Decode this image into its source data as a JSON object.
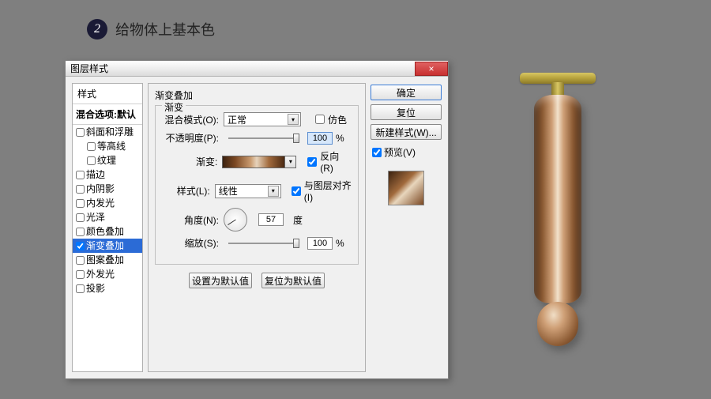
{
  "step": {
    "num": "2",
    "title": "给物体上基本色"
  },
  "dialog": {
    "title": "图层样式",
    "close": "×",
    "sidebar": {
      "heading": "样式",
      "sub": "混合选项:默认",
      "items": [
        {
          "label": "斜面和浮雕",
          "checked": false,
          "indent": false
        },
        {
          "label": "等高线",
          "checked": false,
          "indent": true
        },
        {
          "label": "纹理",
          "checked": false,
          "indent": true
        },
        {
          "label": "描边",
          "checked": false,
          "indent": false
        },
        {
          "label": "内阴影",
          "checked": false,
          "indent": false
        },
        {
          "label": "内发光",
          "checked": false,
          "indent": false
        },
        {
          "label": "光泽",
          "checked": false,
          "indent": false
        },
        {
          "label": "颜色叠加",
          "checked": false,
          "indent": false
        },
        {
          "label": "渐变叠加",
          "checked": true,
          "indent": false,
          "selected": true
        },
        {
          "label": "图案叠加",
          "checked": false,
          "indent": false
        },
        {
          "label": "外发光",
          "checked": false,
          "indent": false
        },
        {
          "label": "投影",
          "checked": false,
          "indent": false
        }
      ]
    },
    "panel": {
      "title": "渐变叠加",
      "legend": "渐变",
      "blendMode": {
        "label": "混合模式(O):",
        "value": "正常"
      },
      "dither": {
        "label": "仿色"
      },
      "opacity": {
        "label": "不透明度(P):",
        "value": "100",
        "unit": "%"
      },
      "gradient": {
        "label": "渐变:"
      },
      "reverse": {
        "label": "反向(R)"
      },
      "style": {
        "label": "样式(L):",
        "value": "线性"
      },
      "align": {
        "label": "与图层对齐(I)"
      },
      "angle": {
        "label": "角度(N):",
        "value": "57",
        "unit": "度"
      },
      "scale": {
        "label": "缩放(S):",
        "value": "100",
        "unit": "%"
      },
      "setDefault": "设置为默认值",
      "resetDefault": "复位为默认值"
    },
    "right": {
      "ok": "确定",
      "reset": "复位",
      "newStyle": "新建样式(W)...",
      "preview": "预览(V)"
    }
  },
  "chart_data": {
    "type": "table",
    "title": "Gradient Overlay settings",
    "rows": [
      {
        "property": "混合模式",
        "value": "正常"
      },
      {
        "property": "仿色",
        "value": false
      },
      {
        "property": "不透明度",
        "value": 100,
        "unit": "%"
      },
      {
        "property": "反向",
        "value": true
      },
      {
        "property": "样式",
        "value": "线性"
      },
      {
        "property": "与图层对齐",
        "value": true
      },
      {
        "property": "角度",
        "value": 57,
        "unit": "度"
      },
      {
        "property": "缩放",
        "value": 100,
        "unit": "%"
      }
    ]
  }
}
